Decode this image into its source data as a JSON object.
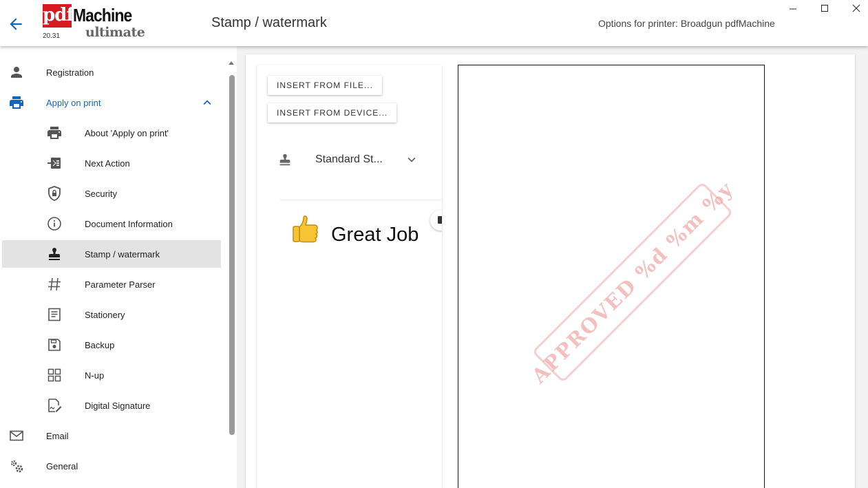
{
  "header": {
    "title": "Stamp / watermark",
    "printer_info": "Options for printer: Broadgun pdfMachine",
    "logo": {
      "pdf": "pdf",
      "machine": "Machine",
      "edition": "ultimate",
      "version": "20.31"
    }
  },
  "sidebar": {
    "items": [
      {
        "label": "Registration",
        "icon": "person-icon"
      },
      {
        "label": "Apply on print",
        "icon": "printer-icon",
        "expanded": true
      },
      {
        "label": "About 'Apply on print'",
        "icon": "printer-icon"
      },
      {
        "label": "Next Action",
        "icon": "login-arrow-icon"
      },
      {
        "label": "Security",
        "icon": "shield-lock-icon"
      },
      {
        "label": "Document Information",
        "icon": "info-icon"
      },
      {
        "label": "Stamp / watermark",
        "icon": "stamp-icon",
        "active": true
      },
      {
        "label": "Parameter Parser",
        "icon": "hash-icon"
      },
      {
        "label": "Stationery",
        "icon": "document-lines-icon"
      },
      {
        "label": "Backup",
        "icon": "floppy-disk-icon"
      },
      {
        "label": "N-up",
        "icon": "grid-four-icon"
      },
      {
        "label": "Digital Signature",
        "icon": "signature-icon"
      },
      {
        "label": "Email",
        "icon": "envelope-icon"
      },
      {
        "label": "General",
        "icon": "gears-icon"
      }
    ]
  },
  "main": {
    "insert_from_file": "INSERT FROM FILE...",
    "insert_from_device": "INSERT FROM DEVICE...",
    "stamp_type": "Standard St...",
    "stamp_preview_text": "Great Job",
    "watermark_text": "APPROVED %d %m %y"
  },
  "colors": {
    "accent": "#1565c0",
    "active_item_bg": "#e3e3e3",
    "logo_red": "#d71920",
    "watermark_red": "#e57373"
  }
}
